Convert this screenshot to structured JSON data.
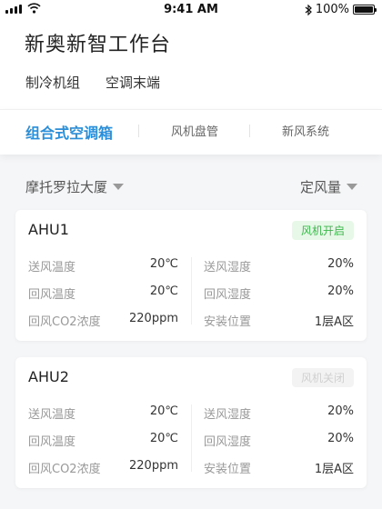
{
  "status_bar": {
    "time": "9:41 AM",
    "battery": "100%",
    "battery_level": 1.0
  },
  "header": {
    "title": "新奥新智工作台",
    "nav": [
      "制冷机组",
      "空调末端"
    ]
  },
  "tabs": [
    {
      "label": "组合式空调箱",
      "active": true
    },
    {
      "label": "风机盘管",
      "active": false
    },
    {
      "label": "新风系统",
      "active": false
    }
  ],
  "filters": {
    "building": "摩托罗拉大厦",
    "mode": "定风量"
  },
  "cards": [
    {
      "name": "AHU1",
      "status": "风机开启",
      "status_on": true,
      "fields": [
        {
          "label": "送风温度",
          "value": "20℃"
        },
        {
          "label": "送风湿度",
          "value": "20%"
        },
        {
          "label": "回风温度",
          "value": "20℃"
        },
        {
          "label": "回风湿度",
          "value": "20%"
        },
        {
          "label": "回风CO2浓度",
          "value": "220ppm"
        },
        {
          "label": "安装位置",
          "value": "1层A区"
        }
      ]
    },
    {
      "name": "AHU2",
      "status": "风机关闭",
      "status_on": false,
      "fields": [
        {
          "label": "送风温度",
          "value": "20℃"
        },
        {
          "label": "送风湿度",
          "value": "20%"
        },
        {
          "label": "回风温度",
          "value": "20℃"
        },
        {
          "label": "回风湿度",
          "value": "20%"
        },
        {
          "label": "回风CO2浓度",
          "value": "220ppm"
        },
        {
          "label": "安装位置",
          "value": "1层A区"
        }
      ]
    }
  ],
  "colors": {
    "accent": "#2b8ed8",
    "status_on_text": "#3cb84c",
    "status_on_bg": "#e8f8e8",
    "status_off_text": "#d0d0d0",
    "status_off_bg": "#f3f3f3"
  }
}
